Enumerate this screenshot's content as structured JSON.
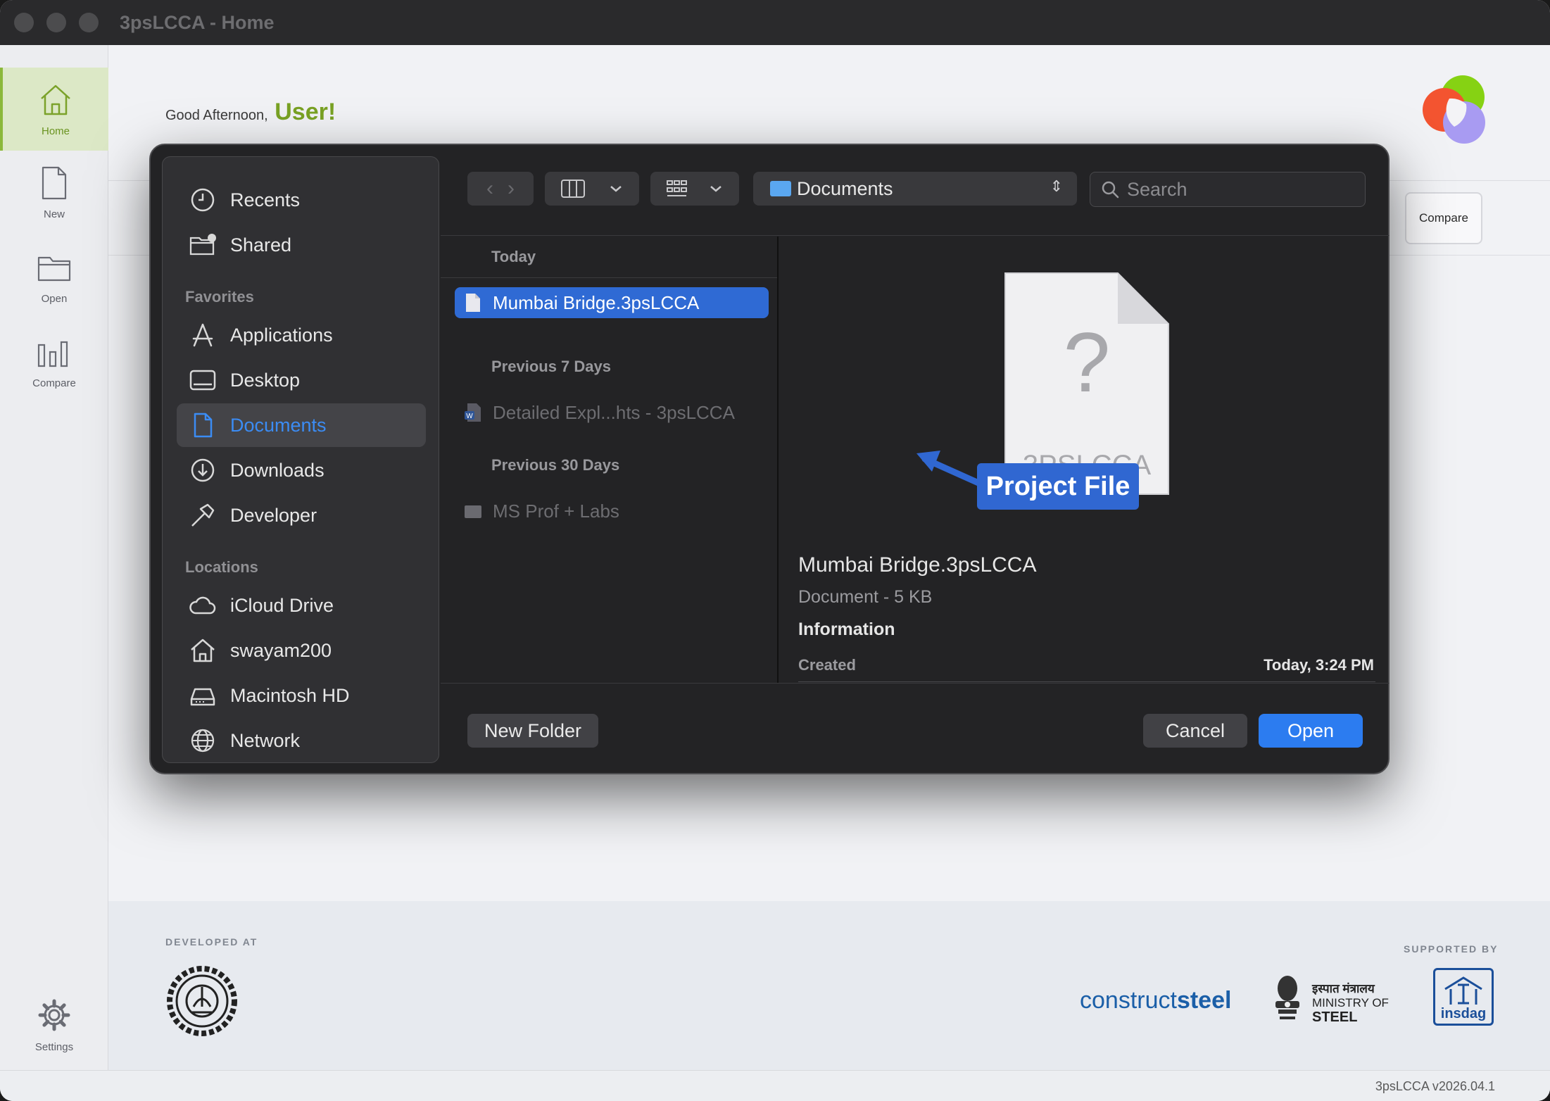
{
  "window": {
    "title": "3psLCCA - Home",
    "version": "3psLCCA v2026.04.1"
  },
  "sidebar": {
    "items": [
      {
        "label": "Home",
        "icon": "home-icon"
      },
      {
        "label": "New",
        "icon": "new-file-icon"
      },
      {
        "label": "Open",
        "icon": "folder-icon"
      },
      {
        "label": "Compare",
        "icon": "bar-chart-icon"
      }
    ],
    "settings_label": "Settings"
  },
  "main": {
    "greeting_prefix": "Good Afternoon,",
    "greeting_name": "User!",
    "compare_button": "Compare",
    "accent_color": "#79a224"
  },
  "footer": {
    "developed_at": "DEVELOPED AT",
    "supported_by": "SUPPORTED BY",
    "constructsteel_light": "construct",
    "constructsteel_bold": "steel",
    "ministry_hindi": "इस्पात मंत्रालय",
    "ministry_line1": "MINISTRY OF",
    "ministry_line2": "STEEL",
    "insdag": "insdag"
  },
  "dialog": {
    "sidebar": {
      "top_items": [
        {
          "label": "Recents",
          "icon": "clock-icon"
        },
        {
          "label": "Shared",
          "icon": "shared-folder-icon"
        }
      ],
      "favorites_label": "Favorites",
      "favorites": [
        {
          "label": "Applications",
          "icon": "applications-icon"
        },
        {
          "label": "Desktop",
          "icon": "desktop-icon"
        },
        {
          "label": "Documents",
          "icon": "document-icon",
          "active": true
        },
        {
          "label": "Downloads",
          "icon": "download-icon"
        },
        {
          "label": "Developer",
          "icon": "hammer-icon"
        }
      ],
      "locations_label": "Locations",
      "locations": [
        {
          "label": "iCloud Drive",
          "icon": "cloud-icon"
        },
        {
          "label": "swayam200",
          "icon": "house-icon"
        },
        {
          "label": "Macintosh HD",
          "icon": "drive-icon"
        },
        {
          "label": "Network",
          "icon": "globe-icon"
        }
      ]
    },
    "location": "Documents",
    "search_placeholder": "Search",
    "groups": [
      {
        "title": "Today",
        "files": [
          {
            "name": "Mumbai Bridge.3psLCCA",
            "selected": true
          }
        ]
      },
      {
        "title": "Previous 7 Days",
        "files": [
          {
            "name": "Detailed Expl...hts - 3psLCCA"
          }
        ]
      },
      {
        "title": "Previous 30 Days",
        "files": [
          {
            "name": "MS Prof + Labs"
          }
        ]
      }
    ],
    "preview": {
      "icon_text": "3PSLCCA",
      "name": "Mumbai Bridge.3psLCCA",
      "meta": "Document - 5 KB",
      "info_label": "Information",
      "created_label": "Created",
      "created_value": "Today, 3:24 PM"
    },
    "new_folder": "New Folder",
    "cancel": "Cancel",
    "open": "Open"
  },
  "annotation": {
    "label": "Project File"
  }
}
